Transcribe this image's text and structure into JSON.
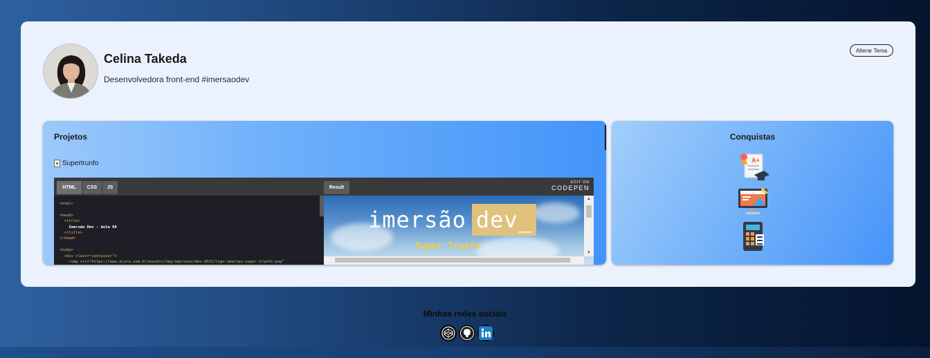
{
  "profile": {
    "name": "Celina Takeda",
    "bio": "Desenvolvedora front-end #imersaodev"
  },
  "header": {
    "theme_button_label": "Alterar Tema"
  },
  "projects": {
    "title": "Projetos",
    "items": [
      {
        "label": "Supertrunfo"
      }
    ],
    "embed": {
      "tabs": [
        "HTML",
        "CSS",
        "JS"
      ],
      "active_tab": "HTML",
      "result_tab": "Result",
      "edit_on": "EDIT ON",
      "brand": "CODEPEN",
      "code_lines": [
        "<html>",
        "",
        "<head>",
        "  <title>",
        "    Imersão Dev - Aula 08",
        "  </title>",
        "</head>",
        "",
        "<body>",
        "  <div class=\"container\">",
        "    <img src=\"https://www.alura.com.br/assets/img/imersoes/dev-2021/logo-imersao-super-trunfo.png\""
      ],
      "banner": {
        "word": "imersão",
        "highlight": "dev_",
        "subtitle": "Super Trunfo"
      }
    }
  },
  "achievements": {
    "title": "Conquistas",
    "badges": [
      "certificate-grade-icon",
      "monitor-design-icon",
      "calculator-icon"
    ]
  },
  "footer": {
    "title": "Minhas redes sociais",
    "links": [
      "codepen-icon",
      "github-icon",
      "linkedin-icon"
    ]
  },
  "colors": {
    "card_bg": "#ebf2fe",
    "panel_accent": "#4394fa",
    "banner_highlight": "#e1c27d",
    "banner_subtitle": "#f3d334"
  }
}
